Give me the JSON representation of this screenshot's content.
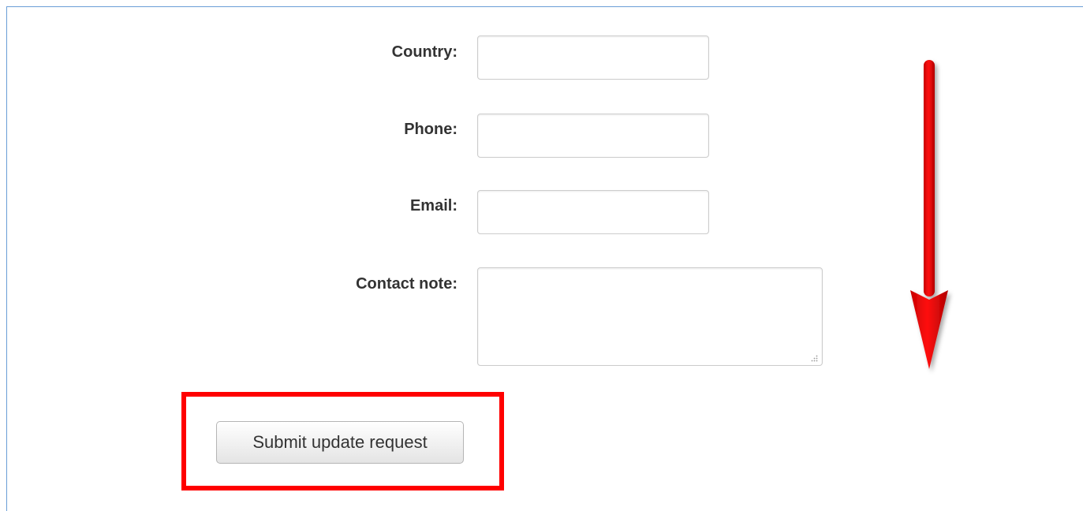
{
  "form": {
    "country": {
      "label": "Country:",
      "value": "",
      "placeholder": ""
    },
    "phone": {
      "label": "Phone:",
      "value": "",
      "placeholder": ""
    },
    "email": {
      "label": "Email:",
      "value": "",
      "placeholder": ""
    },
    "contact_note": {
      "label": "Contact note:",
      "value": "",
      "placeholder": ""
    },
    "submit_label": "Submit update request"
  },
  "annotations": {
    "highlight_color": "#ff0000",
    "arrow_color": "#ff0000",
    "arrow_direction": "down"
  },
  "colors": {
    "frame_border": "#6a9ed6",
    "label_text": "#333333",
    "field_border": "#cccccc"
  }
}
